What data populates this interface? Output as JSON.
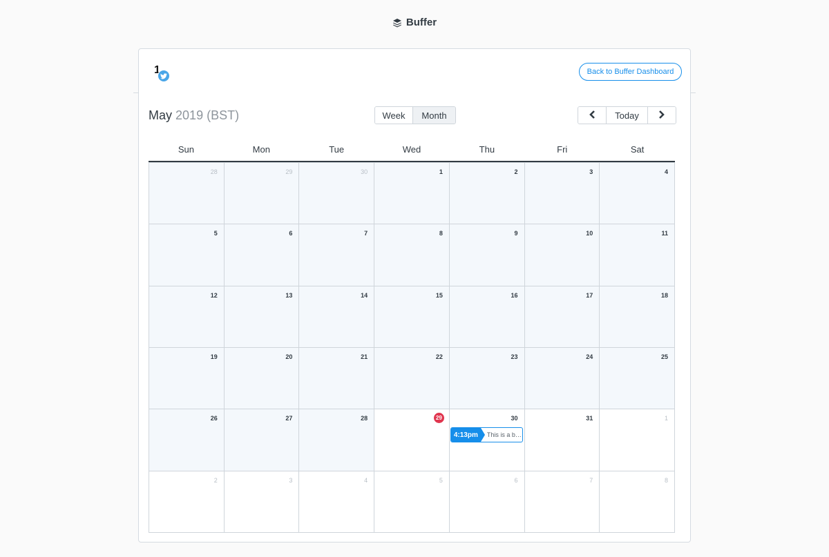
{
  "brand": {
    "name": "Buffer",
    "icon": "buffer-stack-icon"
  },
  "profile": {
    "avatar_initial": "1",
    "network": "twitter"
  },
  "header": {
    "back_label": "Back to Buffer Dashboard"
  },
  "calendar": {
    "month": "May",
    "year_tz": "2019 (BST)",
    "views": {
      "week": "Week",
      "month": "Month",
      "active": "Month"
    },
    "nav": {
      "today": "Today"
    },
    "weekdays": [
      "Sun",
      "Mon",
      "Tue",
      "Wed",
      "Thu",
      "Fri",
      "Sat"
    ],
    "today": "29",
    "weeks": [
      [
        {
          "d": "28",
          "m": true,
          "s": "past"
        },
        {
          "d": "29",
          "m": true,
          "s": "past"
        },
        {
          "d": "30",
          "m": true,
          "s": "past"
        },
        {
          "d": "1",
          "s": "past"
        },
        {
          "d": "2",
          "s": "past"
        },
        {
          "d": "3",
          "s": "past"
        },
        {
          "d": "4",
          "s": "past"
        }
      ],
      [
        {
          "d": "5",
          "s": "past"
        },
        {
          "d": "6",
          "s": "past"
        },
        {
          "d": "7",
          "s": "past"
        },
        {
          "d": "8",
          "s": "past"
        },
        {
          "d": "9",
          "s": "past"
        },
        {
          "d": "10",
          "s": "past"
        },
        {
          "d": "11",
          "s": "past"
        }
      ],
      [
        {
          "d": "12",
          "s": "past"
        },
        {
          "d": "13",
          "s": "past"
        },
        {
          "d": "14",
          "s": "past"
        },
        {
          "d": "15",
          "s": "past"
        },
        {
          "d": "16",
          "s": "past"
        },
        {
          "d": "17",
          "s": "past"
        },
        {
          "d": "18",
          "s": "past"
        }
      ],
      [
        {
          "d": "19",
          "s": "past"
        },
        {
          "d": "20",
          "s": "past"
        },
        {
          "d": "21",
          "s": "past"
        },
        {
          "d": "22",
          "s": "past"
        },
        {
          "d": "23",
          "s": "past"
        },
        {
          "d": "24",
          "s": "past"
        },
        {
          "d": "25",
          "s": "past"
        }
      ],
      [
        {
          "d": "26",
          "s": "past"
        },
        {
          "d": "27",
          "s": "past"
        },
        {
          "d": "28",
          "s": "past"
        },
        {
          "d": "29",
          "s": "today"
        },
        {
          "d": "30",
          "s": "future",
          "post": {
            "time": "4:13pm",
            "text": "This is a bu..."
          }
        },
        {
          "d": "31",
          "s": "future"
        },
        {
          "d": "1",
          "m": true,
          "s": "future"
        }
      ],
      [
        {
          "d": "2",
          "m": true,
          "s": "future"
        },
        {
          "d": "3",
          "m": true,
          "s": "future"
        },
        {
          "d": "4",
          "m": true,
          "s": "future"
        },
        {
          "d": "5",
          "m": true,
          "s": "future"
        },
        {
          "d": "6",
          "m": true,
          "s": "future"
        },
        {
          "d": "7",
          "m": true,
          "s": "future"
        },
        {
          "d": "8",
          "m": true,
          "s": "future"
        }
      ]
    ]
  },
  "colors": {
    "accent": "#168eea",
    "today_badge": "#e0364f",
    "twitter": "#4aa6e8"
  }
}
